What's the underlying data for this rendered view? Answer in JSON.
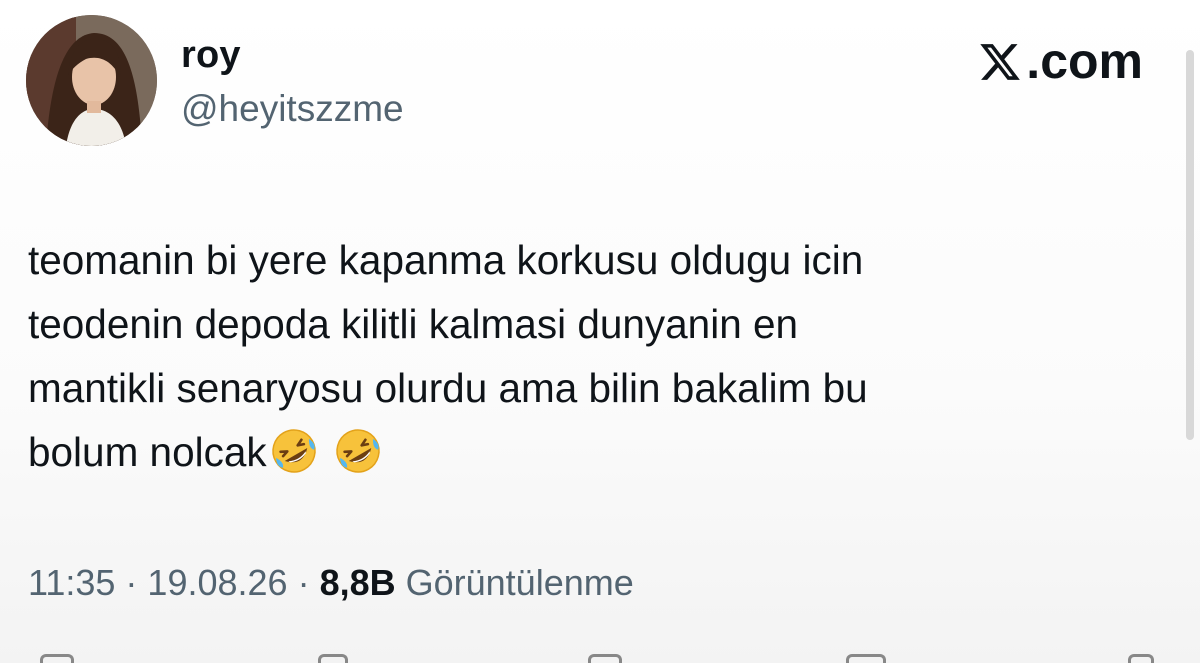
{
  "author": {
    "display_name": "roy",
    "handle": "@heyitszzme"
  },
  "brand": {
    "label": ".com"
  },
  "tweet": {
    "text": "teomanin bi yere kapanma korkusu oldugu icin\nteodenin depoda kilitli kalmasi dunyanin en\nmantikli senaryosu olurdu ama bilin bakalim bu\nbolum nolcak",
    "emojis": [
      "rolling-on-the-floor-laughing-emoji",
      "rolling-on-the-floor-laughing-emoji"
    ]
  },
  "meta": {
    "time": "11:35",
    "separator": " · ",
    "date": "19.08.26",
    "views_count": "8,8B",
    "views_label": "Görüntülenme"
  },
  "colors": {
    "text": "#0f1419",
    "secondary": "#536471"
  }
}
